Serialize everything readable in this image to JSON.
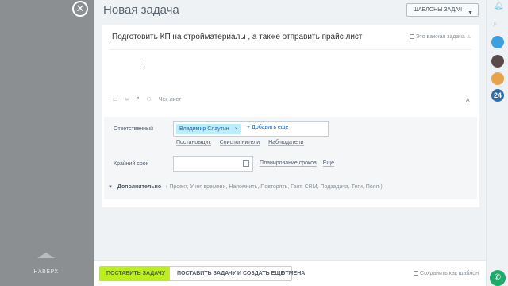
{
  "overlay": {
    "close_icon": "close-icon",
    "scroll_top_label": "НАВЕРХ"
  },
  "header": {
    "title": "Новая задача",
    "templates_label": "ШАБЛОНЫ ЗАДАЧ"
  },
  "task": {
    "title": "Подготовить КП на стройматериалы , а также отправить прайс лист",
    "important_label": "Это важная задача",
    "description_value": ""
  },
  "toolbar": {
    "icons": [
      "video-icon",
      "link-icon",
      "quote-icon",
      "person-icon"
    ],
    "checklist_label": "Чек-лист",
    "font_label": "A"
  },
  "responsible": {
    "label": "Ответственный",
    "user": "Владимир Слаутин",
    "remove_glyph": "×",
    "add_more_label": "+ Добавить еще",
    "roles": [
      "Постановщик",
      "Соисполнители",
      "Наблюдатели"
    ]
  },
  "deadline": {
    "label": "Крайний срок",
    "value": "",
    "plan_label": "Планирование сроков",
    "more_label": "Еще"
  },
  "additional": {
    "label": "Дополнительно",
    "options": "( Проект,  Учет времени,  Напомнить,  Повторять,  Гант,  CRM,  Подзадача,  Теги,  Поля )"
  },
  "footer": {
    "create_label": "ПОСТАВИТЬ ЗАДАЧУ",
    "create_more_label": "ПОСТАВИТЬ ЗАДАЧУ И СОЗДАТЬ ЕЩЕ",
    "cancel_label": "ОТМЕНА",
    "save_template_label": "Сохранить как шаблон"
  },
  "rail": {
    "counter_label": "24"
  },
  "colors": {
    "accent_green": "#bbed21",
    "link_blue": "#2067b0",
    "chip_bg": "#bcedfc",
    "overlay_gray": "#8c8f92"
  }
}
